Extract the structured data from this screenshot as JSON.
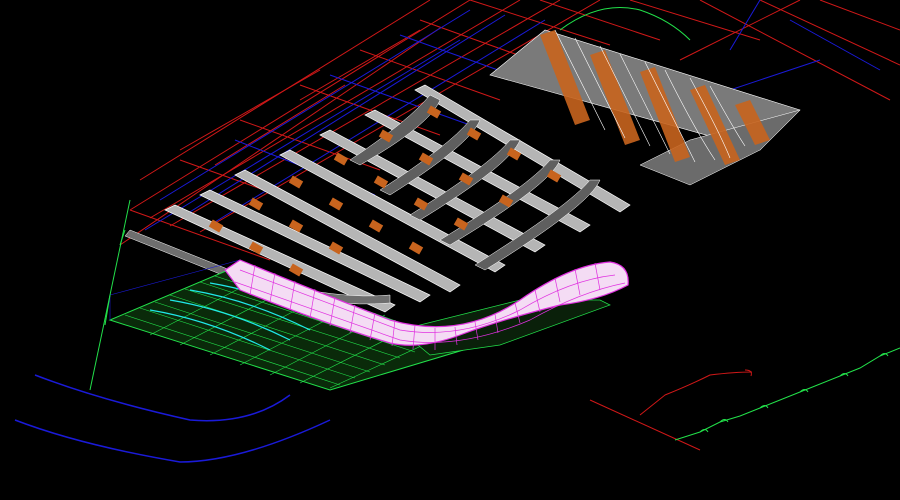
{
  "viewport": {
    "background": "#000000"
  },
  "colors": {
    "grid_red": "#d01818",
    "grid_blue": "#1a1ad8",
    "panel_gray": "#8c8c8c",
    "panel_light": "#c8c8c8",
    "rib_orange": "#c8641e",
    "mesh_green": "#22e04a",
    "mesh_cyan": "#20e8e8",
    "duct_pink": "#f0c8f0",
    "duct_magenta": "#e030e0",
    "wire_white": "#ffffff"
  },
  "objects": [
    {
      "name": "ceiling-grid",
      "kind": "wireframe",
      "color_key": "grid_red"
    },
    {
      "name": "corrugated-panel",
      "kind": "surface",
      "color_key": "panel_gray"
    },
    {
      "name": "beam-grid",
      "kind": "surface",
      "color_key": "panel_light"
    },
    {
      "name": "duct",
      "kind": "surface",
      "color_key": "duct_pink"
    },
    {
      "name": "mesh-floor",
      "kind": "wireframe",
      "color_key": "mesh_green"
    },
    {
      "name": "terrain-profile",
      "kind": "polyline",
      "color_key": "mesh_green"
    }
  ]
}
